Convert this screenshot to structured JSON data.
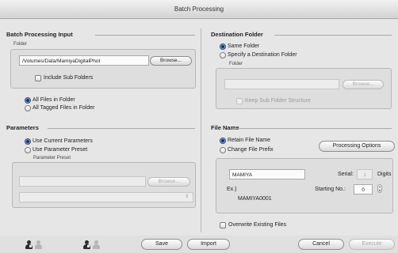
{
  "window": {
    "title": "Batch Processing"
  },
  "input": {
    "title": "Batch Processing Input",
    "folder_label": "Folder",
    "folder_path": "/Volumes/Data/MamiyaDigitalPhot",
    "browse_label": "Browse...",
    "include_sub_folders": "Include Sub Folders",
    "all_files": "All Files in Folder",
    "all_tagged": "All Tagged Files in Folder"
  },
  "destination": {
    "title": "Destination Folder",
    "same_folder": "Same Folder",
    "specify_folder": "Specify a Destination Folder",
    "folder_label": "Folder",
    "browse_label": "Browse...",
    "keep_structure": "Keep Sub Folder Structure"
  },
  "parameters": {
    "title": "Parameters",
    "use_current": "Use Current Parameters",
    "use_preset": "Use Parameter Preset",
    "preset_label": "Parameter Preset",
    "browse_label": "Browse..."
  },
  "file_name": {
    "title": "File Name",
    "retain": "Retain File Name",
    "change_prefix": "Change File Prefix",
    "processing_options": "Processing Options",
    "prefix_value": "MAMIYA",
    "serial_label": "Serial:",
    "serial_value": "1",
    "digits_label": "Digits",
    "example_label": "Ex.)",
    "starting_no_label": "Starting No.:",
    "starting_no_value": "0",
    "example_value": "MAMIYA0001",
    "overwrite": "Overwrite Existing Files"
  },
  "bottom": {
    "save": "Save",
    "import": "Import",
    "cancel": "Cancel",
    "execute": "Execute"
  }
}
